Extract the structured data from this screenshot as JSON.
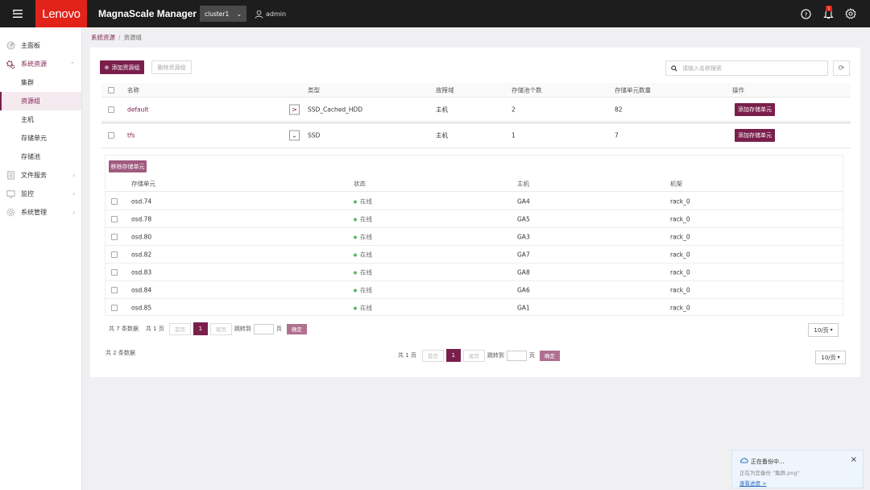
{
  "header": {
    "brand": "Lenovo",
    "app_title": "MagnaScale Manager",
    "cluster": "cluster1",
    "user": "admin"
  },
  "notifications": {
    "badge": "1"
  },
  "sidebar": {
    "items": [
      {
        "label": "主面板",
        "icon": "dashboard-icon"
      },
      {
        "label": "系统资源",
        "icon": "gear-icon"
      },
      {
        "label": "文件服务",
        "icon": "file-service-icon"
      },
      {
        "label": "监控",
        "icon": "monitor-icon"
      },
      {
        "label": "系统管理",
        "icon": "settings-icon"
      }
    ],
    "sub_items": [
      {
        "label": "集群"
      },
      {
        "label": "资源组"
      },
      {
        "label": "主机"
      },
      {
        "label": "存储单元"
      },
      {
        "label": "存储池"
      }
    ]
  },
  "breadcrumb": {
    "root": "系统资源",
    "current": "资源组"
  },
  "toolbar": {
    "add_label": "添加资源组",
    "delete_label": "删除资源组",
    "search_placeholder": "请输入名称搜索"
  },
  "table": {
    "headers": [
      "名称",
      "类型",
      "故障域",
      "存储池个数",
      "存储单元数量",
      "操作"
    ],
    "rows": [
      {
        "name": "default",
        "type": "SSD_Cached_HDD",
        "domain": "主机",
        "pools": "2",
        "units": "82",
        "action": "添加存储单元"
      },
      {
        "name": "tfs",
        "type": "SSD",
        "domain": "主机",
        "pools": "1",
        "units": "7",
        "action": "添加存储单元"
      }
    ]
  },
  "subtable": {
    "remove_label": "移除存储单元",
    "headers": [
      "存储单元",
      "状态",
      "主机",
      "机架"
    ],
    "rows": [
      {
        "unit": "osd.74",
        "status": "在线",
        "host": "GA4",
        "rack": "rack_0"
      },
      {
        "unit": "osd.78",
        "status": "在线",
        "host": "GA5",
        "rack": "rack_0"
      },
      {
        "unit": "osd.80",
        "status": "在线",
        "host": "GA3",
        "rack": "rack_0"
      },
      {
        "unit": "osd.82",
        "status": "在线",
        "host": "GA7",
        "rack": "rack_0"
      },
      {
        "unit": "osd.83",
        "status": "在线",
        "host": "GA8",
        "rack": "rack_0"
      },
      {
        "unit": "osd.84",
        "status": "在线",
        "host": "GA6",
        "rack": "rack_0"
      },
      {
        "unit": "osd.85",
        "status": "在线",
        "host": "GA1",
        "rack": "rack_0"
      }
    ],
    "pager": {
      "total": "共 7 条数据",
      "pages": "共 1 页",
      "first": "首页",
      "current": "1",
      "last": "尾页",
      "jump": "跳转到",
      "page_unit": "页",
      "confirm": "确定",
      "size": "10/页"
    }
  },
  "pager": {
    "total": "共 2 条数据",
    "pages": "共 1 页",
    "first": "首页",
    "current": "1",
    "last": "尾页",
    "jump": "跳转到",
    "page_unit": "页",
    "confirm": "确定",
    "size": "10/页"
  },
  "toast": {
    "title": "正在备份中...",
    "desc": "正在为您备份 \"集群.png\"",
    "link": "查看进度 >"
  },
  "colors": {
    "brand": "#e2231a",
    "accent": "#7a1f4c",
    "online": "#5cb85c"
  }
}
